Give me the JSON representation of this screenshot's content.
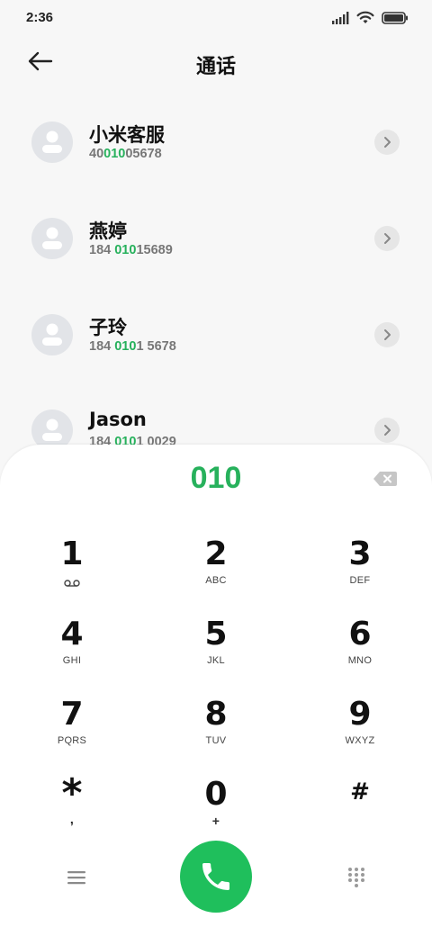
{
  "status_bar": {
    "time": "2:36"
  },
  "header": {
    "title": "通话"
  },
  "contacts": [
    {
      "name": "小米客服",
      "number_pre": "40",
      "number_match": "010",
      "number_post": "05678"
    },
    {
      "name": "燕婷",
      "number_pre": "184 ",
      "number_match": "010",
      "number_post": "15689"
    },
    {
      "name": "子玲",
      "number_pre": "184 ",
      "number_match": "010",
      "number_post": "1 5678"
    },
    {
      "name": "Jason",
      "number_pre": "184 ",
      "number_match": "010",
      "number_post": "1 0029"
    }
  ],
  "dialpad": {
    "input": "010",
    "keys": [
      {
        "digit": "1",
        "letters": ""
      },
      {
        "digit": "2",
        "letters": "ABC"
      },
      {
        "digit": "3",
        "letters": "DEF"
      },
      {
        "digit": "4",
        "letters": "GHI"
      },
      {
        "digit": "5",
        "letters": "JKL"
      },
      {
        "digit": "6",
        "letters": "MNO"
      },
      {
        "digit": "7",
        "letters": "PQRS"
      },
      {
        "digit": "8",
        "letters": "TUV"
      },
      {
        "digit": "9",
        "letters": "WXYZ"
      },
      {
        "digit": "*",
        "letters": ","
      },
      {
        "digit": "0",
        "letters": "+"
      },
      {
        "digit": "#",
        "letters": ""
      }
    ]
  },
  "icons": {
    "back": "arrow-left-icon",
    "chevron": "chevron-right-icon",
    "backspace": "backspace-icon",
    "voicemail": "voicemail-icon",
    "menu": "menu-icon",
    "call": "phone-icon",
    "grid": "dialpad-grid-icon"
  },
  "colors": {
    "accent": "#27b15c",
    "call_button": "#1fbf5c",
    "background": "#f7f7f7",
    "panel": "#ffffff"
  }
}
